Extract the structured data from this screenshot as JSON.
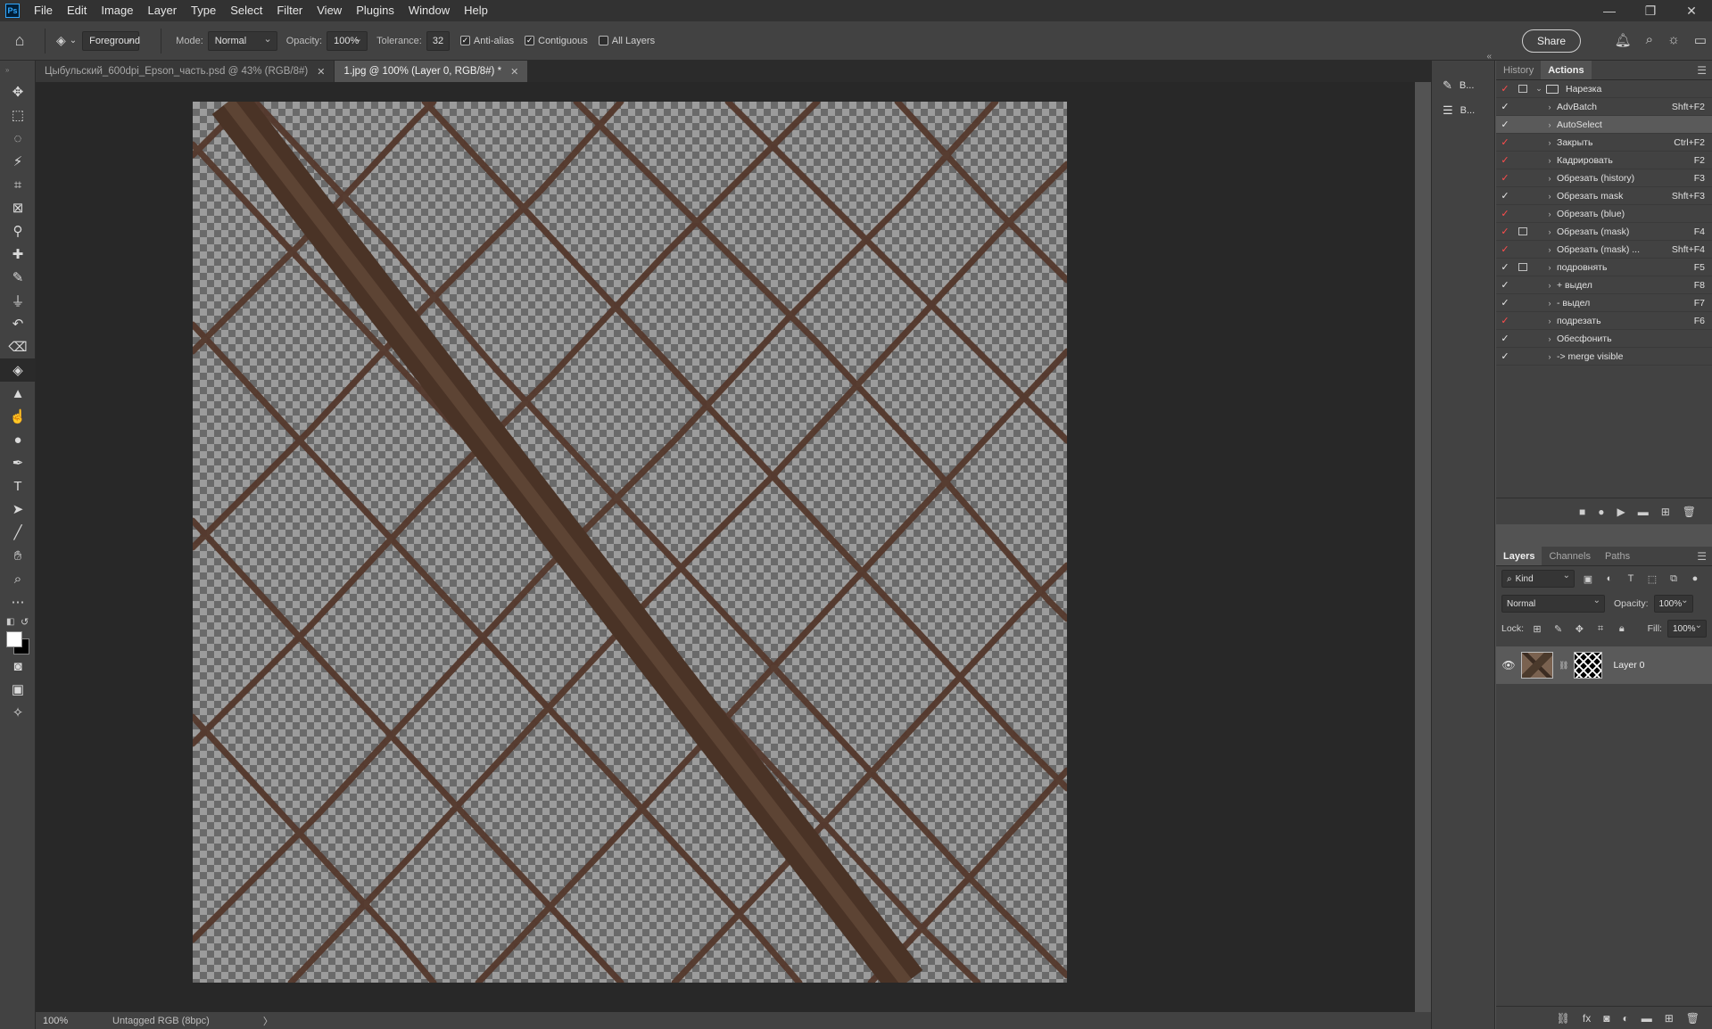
{
  "app": {
    "logo": "Ps"
  },
  "menu": [
    "File",
    "Edit",
    "Image",
    "Layer",
    "Type",
    "Select",
    "Filter",
    "View",
    "Plugins",
    "Window",
    "Help"
  ],
  "window_controls": [
    "—",
    "❐",
    "✕"
  ],
  "options": {
    "fill_source": "Foreground",
    "mode_label": "Mode:",
    "mode_value": "Normal",
    "opacity_label": "Opacity:",
    "opacity_value": "100%",
    "tolerance_label": "Tolerance:",
    "tolerance_value": "32",
    "anti_alias": {
      "label": "Anti-alias",
      "checked": true
    },
    "contiguous": {
      "label": "Contiguous",
      "checked": true
    },
    "all_layers": {
      "label": "All Layers",
      "checked": false
    },
    "share_label": "Share"
  },
  "tabs": [
    {
      "label": "Цыбульский_600dpi_Epson_часть.psd @ 43% (RGB/8#)",
      "active": false
    },
    {
      "label": "1.jpg @ 100% (Layer 0, RGB/8#) *",
      "active": true
    }
  ],
  "tools": [
    "move-tool",
    "marquee-tool",
    "lasso-tool",
    "magic-wand-tool",
    "crop-tool",
    "frame-tool",
    "eyedropper-tool",
    "healing-brush-tool",
    "brush-tool",
    "clone-stamp-tool",
    "history-brush-tool",
    "eraser-tool",
    "paint-bucket-tool",
    "sharpen-tool",
    "smudge-tool",
    "dodge-tool",
    "pen-tool",
    "type-tool",
    "path-selection-tool",
    "line-tool",
    "hand-tool",
    "zoom-tool",
    "more-tools"
  ],
  "colors": {
    "foreground": "#ffffff",
    "background": "#000000",
    "accent": "#31a8ff",
    "check_red": "#ff4d4d"
  },
  "status": {
    "zoom": "100%",
    "profile": "Untagged RGB (8bpc)",
    "chevron": "〉"
  },
  "strip_items": [
    "B...",
    "B..."
  ],
  "history_tab": "History",
  "actions_tab": "Actions",
  "actions": [
    {
      "name": "Нарезка",
      "key": "",
      "folder": true,
      "check_red": true,
      "dialog": true,
      "expanded": true,
      "selected": false
    },
    {
      "name": "AdvBatch",
      "key": "Shft+F2",
      "folder": false,
      "check_red": false,
      "dialog": false,
      "selected": false
    },
    {
      "name": "AutoSelect",
      "key": "",
      "folder": false,
      "check_red": false,
      "dialog": false,
      "selected": true
    },
    {
      "name": "Закрыть",
      "key": "Ctrl+F2",
      "folder": false,
      "check_red": true,
      "dialog": false,
      "selected": false
    },
    {
      "name": "Кадрировать",
      "key": "F2",
      "folder": false,
      "check_red": true,
      "dialog": false,
      "selected": false
    },
    {
      "name": "Обрезать (history)",
      "key": "F3",
      "folder": false,
      "check_red": true,
      "dialog": false,
      "selected": false
    },
    {
      "name": "Обрезать mask",
      "key": "Shft+F3",
      "folder": false,
      "check_red": false,
      "dialog": false,
      "selected": false
    },
    {
      "name": "Обрезать (blue)",
      "key": "",
      "folder": false,
      "check_red": true,
      "dialog": false,
      "selected": false
    },
    {
      "name": "Обрезать (mask)",
      "key": "F4",
      "folder": false,
      "check_red": true,
      "dialog": true,
      "selected": false
    },
    {
      "name": "Обрезать (mask) ...",
      "key": "Shft+F4",
      "folder": false,
      "check_red": true,
      "dialog": false,
      "selected": false
    },
    {
      "name": "подровнять",
      "key": "F5",
      "folder": false,
      "check_red": false,
      "dialog": true,
      "selected": false
    },
    {
      "name": "+ выдел",
      "key": "F8",
      "folder": false,
      "check_red": false,
      "dialog": false,
      "selected": false
    },
    {
      "name": "- выдел",
      "key": "F7",
      "folder": false,
      "check_red": false,
      "dialog": false,
      "selected": false
    },
    {
      "name": "подрезать",
      "key": "F6",
      "folder": false,
      "check_red": true,
      "dialog": false,
      "selected": false
    },
    {
      "name": "Обесфонить",
      "key": "",
      "folder": false,
      "check_red": false,
      "dialog": false,
      "selected": false
    },
    {
      "name": "-> merge visible",
      "key": "",
      "folder": false,
      "check_red": false,
      "dialog": false,
      "selected": false
    }
  ],
  "layers_panel": {
    "tabs": [
      "Layers",
      "Channels",
      "Paths"
    ],
    "filter_kind": "Kind",
    "blend_mode": "Normal",
    "opacity_label": "Opacity:",
    "opacity_value": "100%",
    "lock_label": "Lock:",
    "fill_label": "Fill:",
    "fill_value": "100%",
    "layers": [
      {
        "name": "Layer 0",
        "visible": true
      }
    ]
  }
}
